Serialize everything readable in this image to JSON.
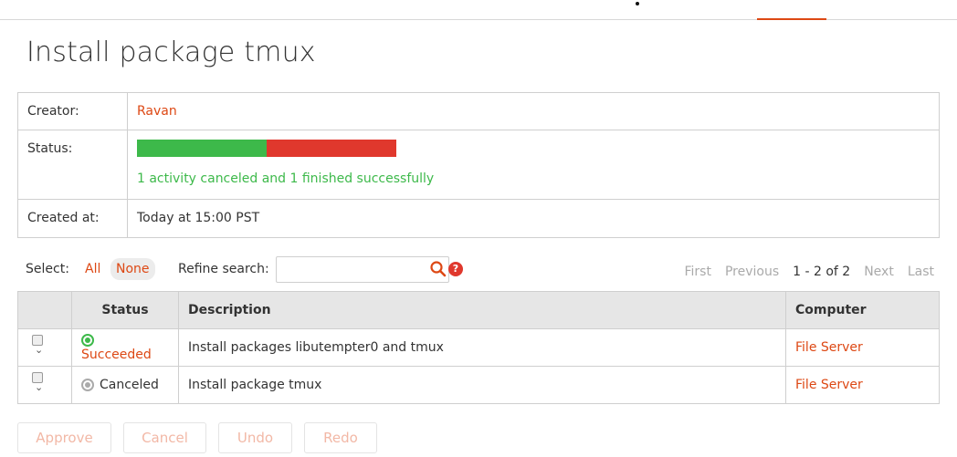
{
  "page": {
    "title": "Install package tmux"
  },
  "info": {
    "creator_label": "Creator:",
    "creator_value": "Ravan",
    "status_label": "Status:",
    "status_text": "1 activity canceled and 1 finished successfully",
    "status_progress": {
      "succeeded_fraction": 0.5,
      "canceled_fraction": 0.5
    },
    "created_label": "Created at:",
    "created_value": "Today at 15:00 PST"
  },
  "controls": {
    "select_label": "Select:",
    "select_all": "All",
    "select_none": "None",
    "refine_label": "Refine search:",
    "search_value": "",
    "search_icon": "search-icon",
    "help_icon": "help-icon",
    "help_glyph": "?"
  },
  "pager": {
    "first": "First",
    "previous": "Previous",
    "current": "1 - 2 of 2",
    "next": "Next",
    "last": "Last"
  },
  "table": {
    "headers": [
      "",
      "Status",
      "Description",
      "Computer"
    ],
    "rows": [
      {
        "status": "Succeeded",
        "description": "Install packages libutempter0 and tmux",
        "computer": "File Server"
      },
      {
        "status": "Canceled",
        "description": "Install package tmux",
        "computer": "File Server"
      }
    ]
  },
  "actions": {
    "approve": "Approve",
    "cancel": "Cancel",
    "undo": "Undo",
    "redo": "Redo"
  },
  "colors": {
    "accent": "#dd4814",
    "success": "#3db94a",
    "failure": "#e0382d"
  }
}
